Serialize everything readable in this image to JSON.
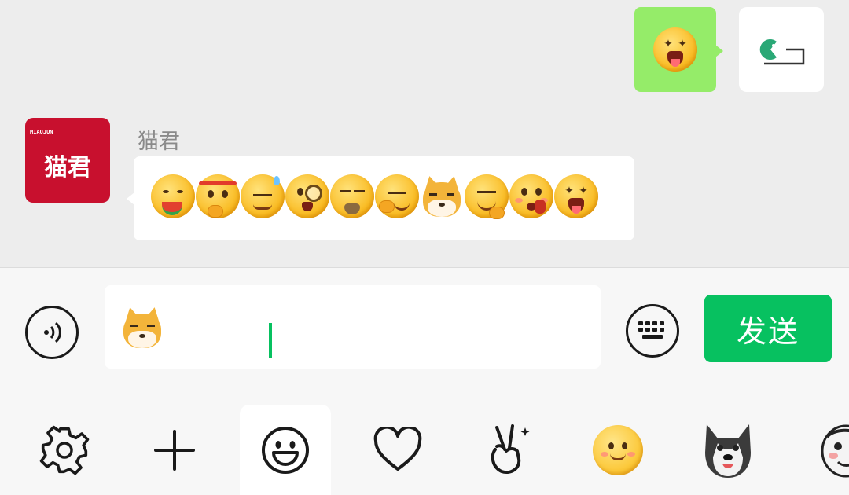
{
  "chat": {
    "outgoing": {
      "emoji": "star-eyes-tongue-face"
    },
    "incoming": {
      "sender_name": "猫君",
      "avatar_text": "猫君",
      "avatar_small_text": "MIAOJUN",
      "emojis": [
        "eating-watermelon-face",
        "headband-shush-face",
        "sweat-flat-face",
        "monocle-face",
        "beard-face",
        "smirk-face",
        "doge-face",
        "smug-thumb-face",
        "blush-hand-face",
        "star-eyes-tongue-face"
      ]
    }
  },
  "input_bar": {
    "input_content": "doge-face",
    "send_label": "发送",
    "voice_icon": "voice-icon",
    "keyboard_icon": "keyboard-icon"
  },
  "tabs": [
    {
      "icon": "settings-icon"
    },
    {
      "icon": "plus-icon"
    },
    {
      "icon": "smiley-icon",
      "selected": true
    },
    {
      "icon": "heart-icon"
    },
    {
      "icon": "victory-hand-icon"
    },
    {
      "icon": "yellow-smiley-sticker-icon"
    },
    {
      "icon": "husky-sticker-icon"
    },
    {
      "icon": "meme-face-sticker-icon"
    }
  ],
  "colors": {
    "accent": "#07c160",
    "outgoing_bubble": "#95ec69",
    "avatar_red": "#c8102e",
    "chat_bg": "#ededed"
  }
}
